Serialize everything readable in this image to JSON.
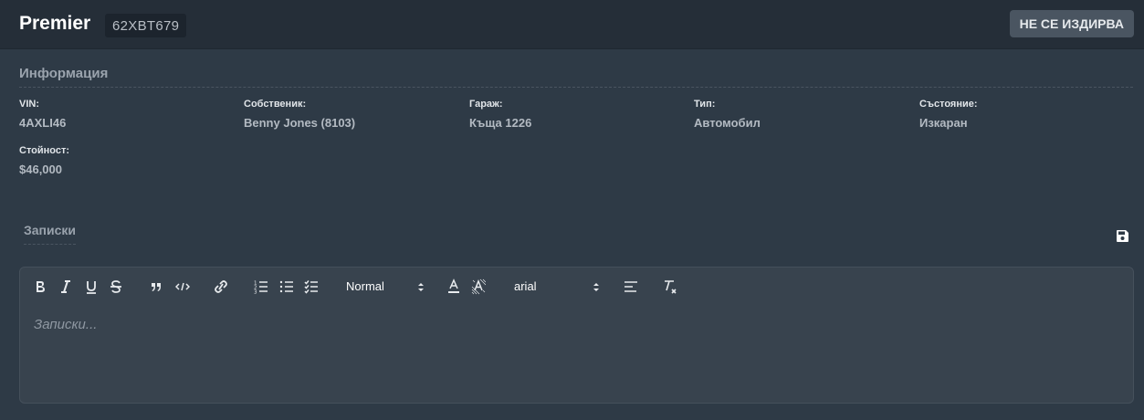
{
  "header": {
    "title": "Premier",
    "plate": "62XBT679",
    "status_button": "НЕ СЕ ИЗДИРВА"
  },
  "info": {
    "section_title": "Информация",
    "fields": [
      {
        "label": "VIN:",
        "value": "4AXLI46"
      },
      {
        "label": "Собственик:",
        "value": "Benny Jones (8103)"
      },
      {
        "label": "Гараж:",
        "value": "Къща 1226"
      },
      {
        "label": "Тип:",
        "value": "Автомобил"
      },
      {
        "label": "Състояние:",
        "value": "Изкаран"
      },
      {
        "label": "Стойност:",
        "value": "$46,000"
      }
    ]
  },
  "notes": {
    "section_title": "Записки",
    "placeholder": "Записки...",
    "toolbar": {
      "header_select": "Normal",
      "font_select": "arial",
      "icons": [
        "bold-icon",
        "italic-icon",
        "underline-icon",
        "strikethrough-icon",
        "blockquote-icon",
        "code-icon",
        "link-icon",
        "ordered-list-icon",
        "bullet-list-icon",
        "checklist-icon",
        "text-color-icon",
        "background-color-icon",
        "align-icon",
        "clear-format-icon"
      ]
    }
  }
}
